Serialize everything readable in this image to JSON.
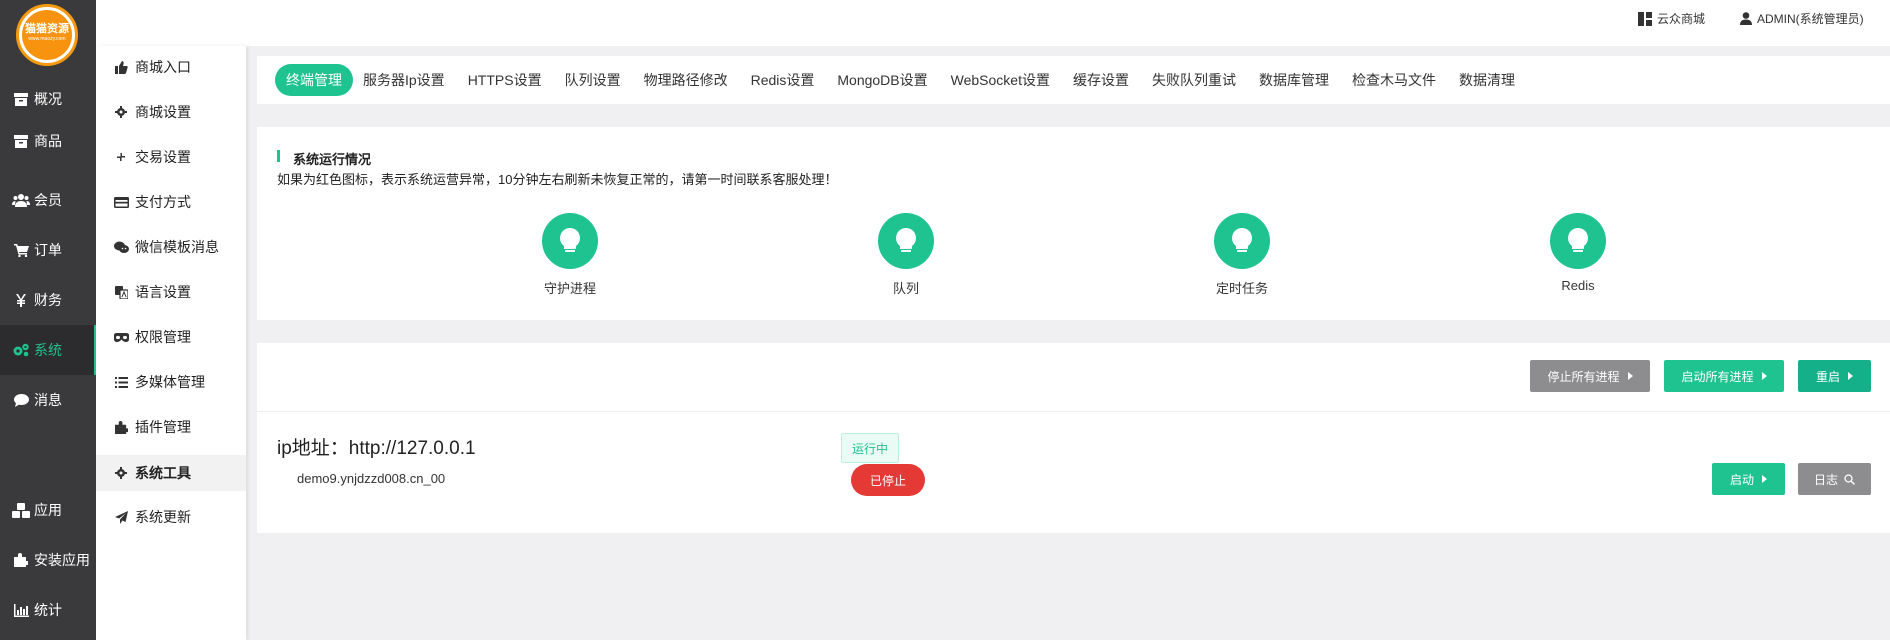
{
  "logo": {
    "text": "猫猫资源",
    "sub": "www.maozy.com"
  },
  "main_nav": [
    {
      "label": "概况",
      "icon": "archive-icon"
    },
    {
      "label": "商品",
      "icon": "archive-icon"
    },
    {
      "label": "会员",
      "icon": "users-icon"
    },
    {
      "label": "订单",
      "icon": "cart-icon"
    },
    {
      "label": "财务",
      "icon": "yen-icon"
    },
    {
      "label": "系统",
      "icon": "gears-icon",
      "active": true
    },
    {
      "label": "消息",
      "icon": "chat-icon"
    },
    {
      "label": "应用",
      "icon": "cubes-icon"
    },
    {
      "label": "安装应用",
      "icon": "puzzle-icon"
    },
    {
      "label": "统计",
      "icon": "bar-chart-icon"
    }
  ],
  "sub_nav": [
    {
      "label": "商城入口",
      "icon": "thumbs-up-icon"
    },
    {
      "label": "商城设置",
      "icon": "gear-icon"
    },
    {
      "label": "交易设置",
      "icon": "compress-icon"
    },
    {
      "label": "支付方式",
      "icon": "credit-card-icon"
    },
    {
      "label": "微信模板消息",
      "icon": "wechat-icon"
    },
    {
      "label": "语言设置",
      "icon": "translate-icon"
    },
    {
      "label": "权限管理",
      "icon": "mask-icon"
    },
    {
      "label": "多媒体管理",
      "icon": "list-icon"
    },
    {
      "label": "插件管理",
      "icon": "puzzle-icon"
    },
    {
      "label": "系统工具",
      "icon": "gear-icon",
      "active": true
    },
    {
      "label": "系统更新",
      "icon": "paper-plane-icon"
    }
  ],
  "topbar": {
    "store_label": "云众商城",
    "user_label": "ADMIN(系统管理员)"
  },
  "tabs": [
    {
      "label": "终端管理",
      "active": true
    },
    {
      "label": "服务器Ip设置"
    },
    {
      "label": "HTTPS设置"
    },
    {
      "label": "队列设置"
    },
    {
      "label": "物理路径修改"
    },
    {
      "label": "Redis设置"
    },
    {
      "label": "MongoDB设置"
    },
    {
      "label": "WebSocket设置"
    },
    {
      "label": "缓存设置"
    },
    {
      "label": "失败队列重试"
    },
    {
      "label": "数据库管理"
    },
    {
      "label": "检查木马文件"
    },
    {
      "label": "数据清理"
    }
  ],
  "status": {
    "title": "系统运行情况",
    "description": "如果为红色图标，表示系统运营异常，10分钟左右刷新未恢复正常的，请第一时间联系客服处理！",
    "items": [
      {
        "label": "守护进程",
        "icon": "lightbulb-icon",
        "color": "#1fc38f"
      },
      {
        "label": "队列",
        "icon": "lightbulb-icon",
        "color": "#1fc38f"
      },
      {
        "label": "定时任务",
        "icon": "lightbulb-icon",
        "color": "#1fc38f"
      },
      {
        "label": "Redis",
        "icon": "lightbulb-icon",
        "color": "#1fc38f"
      }
    ]
  },
  "process": {
    "stop_all": "停止所有进程",
    "start_all": "启动所有进程",
    "restart": "重启",
    "ip_label": "ip地址：http://127.0.0.1",
    "domain": "demo9.ynjdzzd008.cn_00",
    "running_badge": "运行中",
    "stopped_badge": "已停止",
    "start": "启动",
    "log": "日志"
  },
  "colors": {
    "accent": "#1fc38f",
    "danger": "#e53935",
    "gray": "#8d8d8f",
    "sidebar": "#3a3a3c"
  }
}
